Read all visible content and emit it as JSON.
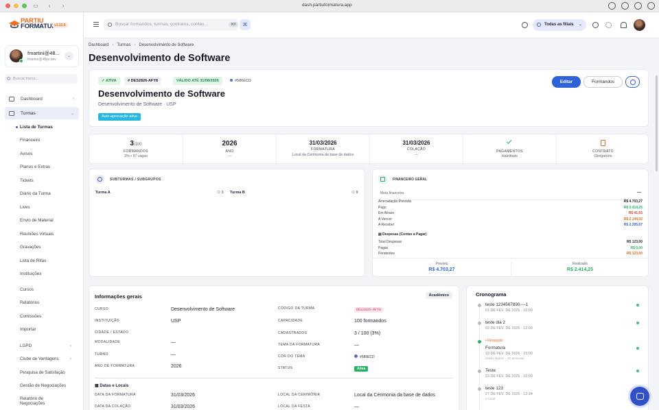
{
  "browser": {
    "url": "dash.partiuformatura.app"
  },
  "app": {
    "logo_line1": "PARTIU",
    "logo_line2": "FORMATURA",
    "version": "v1.12.6"
  },
  "user": {
    "name": "fmartini@48...",
    "email": "fmartini@48px.dev"
  },
  "sidebar": {
    "search_placeholder": "Buscar menu...",
    "items": [
      {
        "label": "Dashboard"
      },
      {
        "label": "Turmas"
      }
    ],
    "sub_items": [
      "Lista de Turmas",
      "Financeiro",
      "Avisos",
      "Planos e Extras",
      "Tickets",
      "Diário da Turma",
      "Lives",
      "Envio de Material",
      "Reuniões Virtuais",
      "Gravações",
      "Lista de Rifas",
      "Instituições"
    ],
    "plain_items": [
      "Cursos",
      "Relatórios",
      "Comissões",
      "Importar",
      "LGPD",
      "Clube de Vantagens",
      "Pesquisa de Satisfação",
      "Gestão de Negociações",
      "Relatório de",
      "Negociações"
    ]
  },
  "topbar": {
    "search_placeholder": "Buscar formandos, turmas, contratos, contas...",
    "shortcut": "⌘K",
    "branch_filter": "Todas as filiais"
  },
  "breadcrumb": {
    "items": [
      "Dashboard",
      "Turmas",
      "Desenvolvimento de Software"
    ]
  },
  "page": {
    "title": "Desenvolvimento de Software"
  },
  "hero": {
    "status": "✓ ATIVA",
    "code": "# DES2826-AFY8",
    "valid": "VÁLIDO ATÉ 31/08/2026",
    "color": "#586ECD",
    "title": "Desenvolvimento de Software",
    "subtitle": "Desenvolvimento de Software  ·  USP",
    "auto_approve": "Auto-aprovação ativa",
    "edit_button": "Editar",
    "students_button": "Formandos"
  },
  "stats": [
    {
      "big": "3",
      "small": "/100",
      "label": "FORMANDOS",
      "sub": "3% • 97 vagas"
    },
    {
      "big": "2026",
      "small": "",
      "label": "ANO",
      "sub": "—"
    },
    {
      "big": "31/03/2026",
      "small": "",
      "label": "FORMATURA",
      "sub": "Local da Cerimonia da base de dados"
    },
    {
      "big": "31/03/2026",
      "small": "",
      "label": "COLAÇÃO",
      "sub": "—"
    },
    {
      "big": "",
      "small": "",
      "label": "PAGAMENTOS",
      "sub": "Habilitado"
    },
    {
      "big": "",
      "small": "",
      "label": "CONTRATO",
      "sub": "Obrigatório"
    }
  ],
  "subturmas": {
    "title": "SUBTURMAS / SUBGRUPOS",
    "items": [
      {
        "name": "Turma A",
        "count": "3"
      },
      {
        "name": "Turma B",
        "count": "9"
      }
    ]
  },
  "financeiro": {
    "title": "FINANCEIRO GERAL",
    "meta_label": "Meta financeira",
    "meta_value": "—",
    "rows": [
      {
        "label": "Arrecadação Prevista",
        "value": "R$ 4.703,27",
        "color": "#1f2430"
      },
      {
        "label": "Pago",
        "value": "R$ 2.414,25",
        "color": "#27b064"
      },
      {
        "label": "Em Atraso",
        "value": "R$ 41,65",
        "color": "#e0412e"
      },
      {
        "label": "A Vencer",
        "value": "R$ 2.144,02",
        "color": "#e06b22"
      },
      {
        "label": "A Receber",
        "value": "R$ 2.205,67",
        "color": "#2f62d8"
      }
    ],
    "despesas_title": "Despesas (Contas a Pagar)",
    "despesas": [
      {
        "label": "Total Despesas",
        "value": "R$ 123,00",
        "color": "#1f2430"
      },
      {
        "label": "Pagas",
        "value": "R$ 0,00",
        "color": "#27b064"
      },
      {
        "label": "Pendentes",
        "value": "R$ 123,00",
        "color": "#e06b22"
      }
    ],
    "previsto_label": "Previsto",
    "previsto_value": "R$ 4.703,27",
    "realizado_label": "Realizado",
    "realizado_value": "R$ 2.414,25"
  },
  "info": {
    "title": "Informações gerais",
    "tag": "Acadêmico",
    "left": [
      {
        "label": "CURSO",
        "value": "Desenvolvimento de Software"
      },
      {
        "label": "INSTITUIÇÃO",
        "value": "USP"
      },
      {
        "label": "CIDADE / ESTADO",
        "value": ""
      },
      {
        "label": "MODALIDADE",
        "value": "—"
      },
      {
        "label": "TURNO",
        "value": "—"
      },
      {
        "label": "ANO DE FORMATURA",
        "value": "2026"
      }
    ],
    "right": [
      {
        "label": "CÓDIGO DA TURMA",
        "value": "DES2826-AFY8"
      },
      {
        "label": "CAPACIDADE",
        "value": "100 formandos"
      },
      {
        "label": "CADASTRADOS",
        "value": "3 / 100 (3%)"
      },
      {
        "label": "TEMA DA FORMATURA",
        "value": "—"
      },
      {
        "label": "COR DO TEMA",
        "value": "#586ECD"
      },
      {
        "label": "STATUS",
        "value": "Ativa"
      }
    ],
    "dates_title": "Datas e Locais",
    "dates_left": [
      {
        "label": "DATA DA FORMATURA",
        "value": "31/03/2026"
      },
      {
        "label": "DATA DA COLAÇÃO",
        "value": "31/03/2026"
      }
    ],
    "dates_right": [
      {
        "label": "LOCAL DA CERIMÔNIA",
        "value": "Local da Cerimonia da base de dados"
      },
      {
        "label": "LOCAL DA FESTA",
        "value": "—"
      }
    ]
  },
  "cronograma": {
    "title": "Cronograma",
    "items": [
      {
        "tag": "",
        "title": "teste 1234567890----1",
        "date": "01 DE FEV. DE 2026 · 10:00",
        "note": ""
      },
      {
        "tag": "",
        "title": "teste dia 2",
        "date": "02 DE FEV. DE 2026 · 12:00",
        "note": ""
      },
      {
        "tag": "• Recepção",
        "title": "Formatura",
        "date": "19 DE FEV. DE 2026 · 23:00",
        "note": "Salão Nobre · 12 pessoas"
      },
      {
        "tag": "",
        "title": "Teste",
        "date": "23 DE FEV. DE 2026 · 10:00",
        "note": ""
      },
      {
        "tag": "",
        "title": "teste 123",
        "date": "27 DE FEV. DE 2026 · 12:34",
        "note": "1 local"
      }
    ]
  }
}
